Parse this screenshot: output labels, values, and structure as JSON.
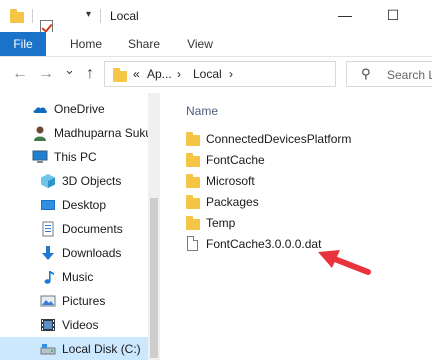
{
  "window": {
    "title": "Local",
    "minimize": "—",
    "maximize": "☐"
  },
  "ribbon": {
    "tabs": [
      "File",
      "Home",
      "Share",
      "View"
    ]
  },
  "nav": {
    "back": "←",
    "forward": "→",
    "recent": "⌄",
    "up": "↑",
    "breadcrumb": [
      "«",
      "Ap...",
      "›",
      "Local",
      "›"
    ],
    "dropdown": "⌄",
    "refresh": "↻"
  },
  "search": {
    "icon": "⚲",
    "placeholder": "Search L"
  },
  "sidebar": {
    "items": [
      {
        "label": "OneDrive",
        "icon": "onedrive-icon"
      },
      {
        "label": "Madhuparna Suku",
        "icon": "user-icon"
      },
      {
        "label": "This PC",
        "icon": "computer-icon"
      },
      {
        "label": "3D Objects",
        "icon": "3d-objects-icon"
      },
      {
        "label": "Desktop",
        "icon": "desktop-icon"
      },
      {
        "label": "Documents",
        "icon": "documents-icon"
      },
      {
        "label": "Downloads",
        "icon": "downloads-icon"
      },
      {
        "label": "Music",
        "icon": "music-icon"
      },
      {
        "label": "Pictures",
        "icon": "pictures-icon"
      },
      {
        "label": "Videos",
        "icon": "videos-icon"
      },
      {
        "label": "Local Disk (C:)",
        "icon": "drive-icon"
      }
    ]
  },
  "main": {
    "column_header": "Name",
    "files": [
      {
        "name": "ConnectedDevicesPlatform",
        "type": "folder"
      },
      {
        "name": "FontCache",
        "type": "folder"
      },
      {
        "name": "Microsoft",
        "type": "folder"
      },
      {
        "name": "Packages",
        "type": "folder"
      },
      {
        "name": "Temp",
        "type": "folder"
      },
      {
        "name": "FontCache3.0.0.0.dat",
        "type": "file"
      }
    ]
  },
  "colors": {
    "accent": "#1a73c9",
    "folder": "#f5c545",
    "annotation_arrow": "#e8323c",
    "selected": "#cce8ff"
  }
}
